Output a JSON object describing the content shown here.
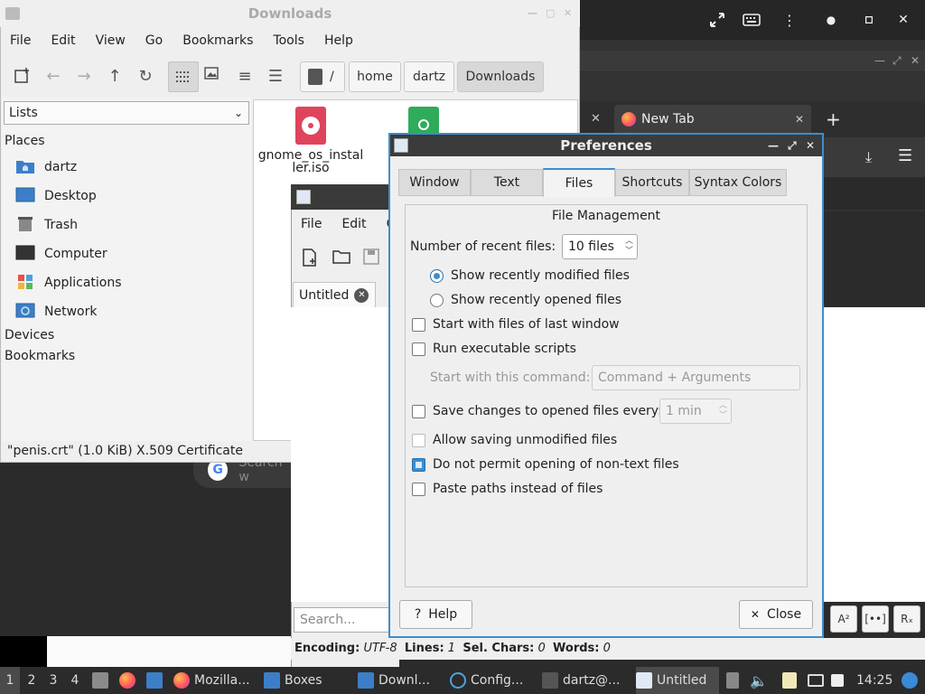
{
  "remote_bar": {
    "icons": [
      "fullscreen-icon",
      "keyboard-icon",
      "more-vert-icon",
      "minimize-icon",
      "maximize-icon",
      "close-icon"
    ]
  },
  "browser": {
    "new_tab_label": "New Tab",
    "search_hint": "Search w"
  },
  "file_manager": {
    "title": "Downloads",
    "menu": [
      "File",
      "Edit",
      "View",
      "Go",
      "Bookmarks",
      "Tools",
      "Help"
    ],
    "breadcrumbs": [
      "/",
      "home",
      "dartz",
      "Downloads"
    ],
    "side_select": "Lists",
    "places_header": "Places",
    "places": [
      "dartz",
      "Desktop",
      "Trash",
      "Computer",
      "Applications",
      "Network"
    ],
    "devices_header": "Devices",
    "bookmarks_header": "Bookmarks",
    "files": [
      {
        "name": "gnome_os_installer.iso",
        "label_line1": "gnome_os_instal",
        "label_line2": "ler.iso"
      }
    ],
    "status": "\"penis.crt\" (1.0 KiB) X.509 Certificate"
  },
  "mousepad": {
    "menu": [
      "File",
      "Edit",
      "C"
    ],
    "tab_label": "Untitled",
    "search_placeholder": "Search...",
    "status": {
      "encoding_label": "Encoding:",
      "encoding": "UTF-8",
      "lines_label": "Lines:",
      "lines": "1",
      "sel_label": "Sel. Chars:",
      "sel": "0",
      "words_label": "Words:",
      "words": "0"
    },
    "btn_a": "A²",
    "btn_b": "[••]",
    "btn_c": "Rₓ"
  },
  "preferences": {
    "title": "Preferences",
    "tabs": [
      "Window",
      "Text",
      "Files",
      "Shortcuts",
      "Syntax Colors"
    ],
    "active_tab": "Files",
    "section": "File Management",
    "recent_label": "Number of recent files:",
    "recent_value": "10 files",
    "radio_modified": "Show recently modified files",
    "radio_opened": "Show recently opened files",
    "start_last_window": "Start with files of last window",
    "run_scripts": "Run executable scripts",
    "start_command_label": "Start with this command:",
    "start_command_placeholder": "Command + Arguments",
    "save_changes_label": "Save changes to opened files every:",
    "save_interval": "1 min",
    "allow_unmodified": "Allow saving unmodified files",
    "no_nontext": "Do not permit opening of non-text files",
    "paste_paths": "Paste paths instead of files",
    "help_button": "Help",
    "close_button": "Close"
  },
  "taskbar": {
    "workspaces": [
      "1",
      "2",
      "3",
      "4"
    ],
    "tasks": [
      "Mozilla...",
      "Boxes",
      "Downl...",
      "Config...",
      "dartz@...",
      "Untitled"
    ],
    "clock": "14:25"
  }
}
